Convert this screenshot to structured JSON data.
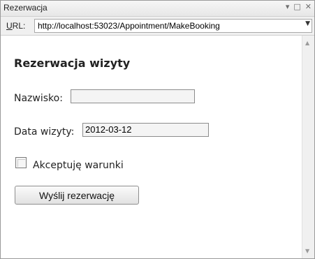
{
  "window": {
    "title": "Rezerwacja"
  },
  "address": {
    "label_prefix": "U",
    "label_rest": "RL:",
    "url": "http://localhost:53023/Appointment/MakeBooking"
  },
  "form": {
    "heading": "Rezerwacja wizyty",
    "name_label": "Nazwisko:",
    "name_value": "",
    "date_label": "Data wizyty:",
    "date_value": "2012-03-12",
    "terms_label": "Akceptuję warunki",
    "terms_checked": false,
    "submit_label": "Wyślij rezerwację"
  }
}
